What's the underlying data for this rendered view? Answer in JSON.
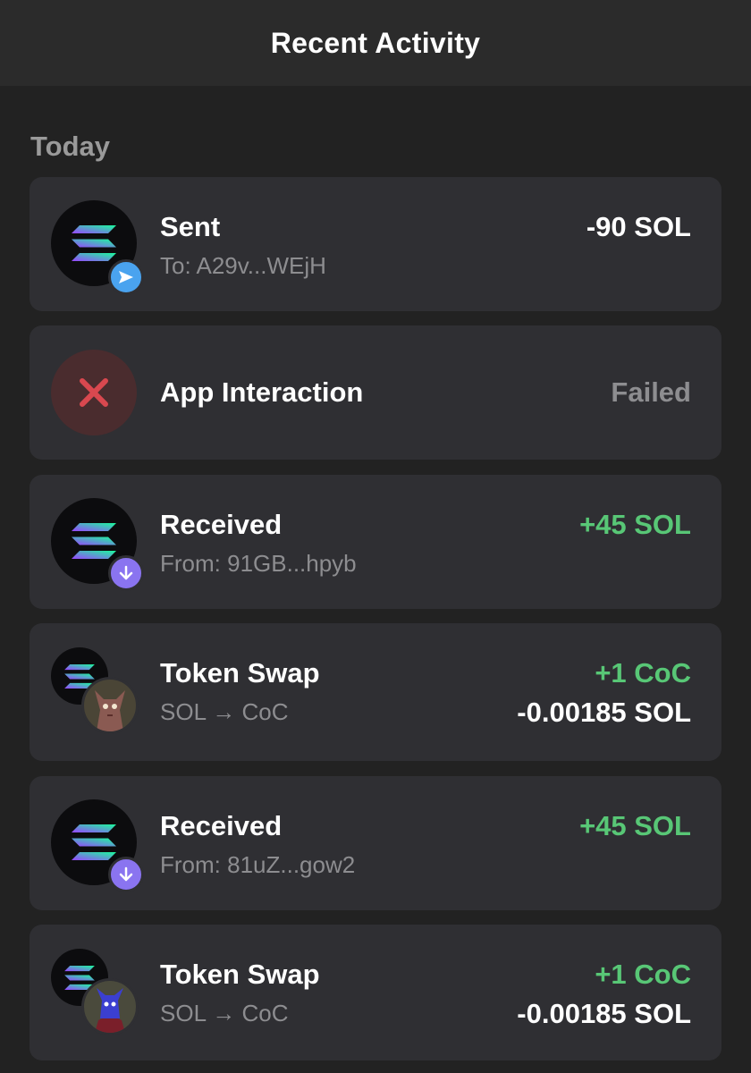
{
  "header": {
    "title": "Recent Activity"
  },
  "section": {
    "label": "Today"
  },
  "colors": {
    "background": "#222222",
    "card": "#2f2f33",
    "positive": "#58c776",
    "muted": "#8d8d90",
    "send_badge": "#4aa3ef",
    "receive_badge": "#8a74f0",
    "failed": "#d9484f"
  },
  "activities": [
    {
      "title": "Sent",
      "subtitle": "To: A29v...WEjH",
      "amount": "-90 SOL",
      "icon": "solana-logo-icon",
      "badge": "send-arrow-icon"
    },
    {
      "title": "App Interaction",
      "amount": "Failed",
      "icon": "failed-x-icon"
    },
    {
      "title": "Received",
      "subtitle": "From: 91GB...hpyb",
      "amount": "+45 SOL",
      "icon": "solana-logo-icon",
      "badge": "receive-arrow-icon"
    },
    {
      "title": "Token Swap",
      "subtitle": "SOL → CoC",
      "amount_in": "+1 CoC",
      "amount_out": "-0.00185 SOL",
      "icon": "solana-logo-icon",
      "token_icon": "coc-token-icon"
    },
    {
      "title": "Received",
      "subtitle": "From: 81uZ...gow2",
      "amount": "+45 SOL",
      "icon": "solana-logo-icon",
      "badge": "receive-arrow-icon"
    },
    {
      "title": "Token Swap",
      "subtitle": "SOL → CoC",
      "amount_in": "+1 CoC",
      "amount_out": "-0.00185 SOL",
      "icon": "solana-logo-icon",
      "token_icon": "coc-token-icon"
    }
  ]
}
